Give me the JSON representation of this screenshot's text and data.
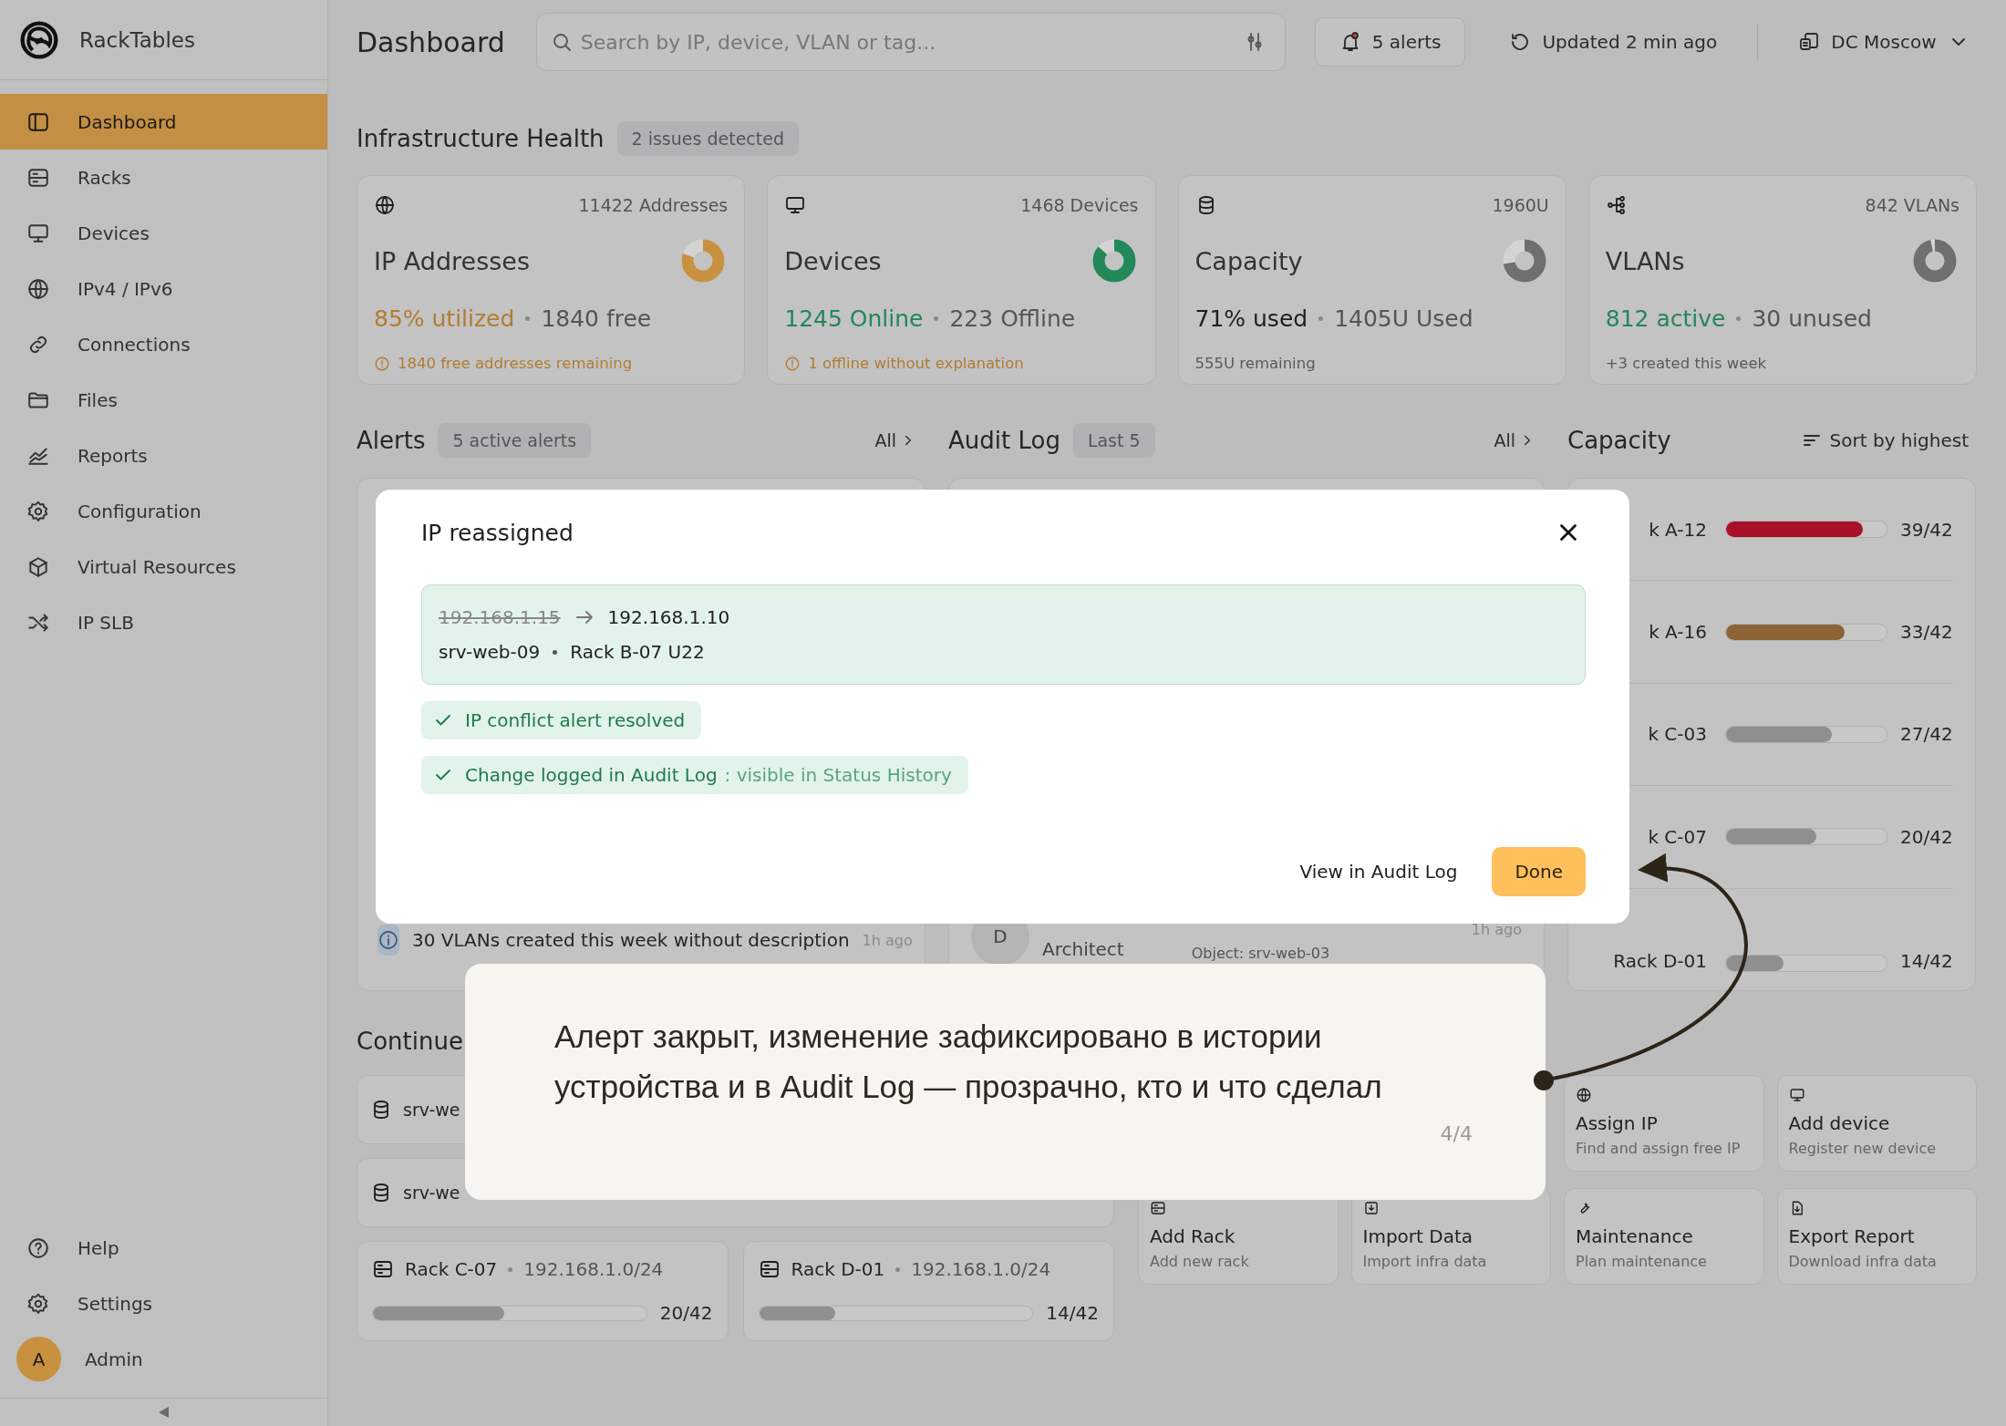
{
  "sidebar": {
    "brand": "RackTables",
    "items": [
      {
        "label": "Dashboard",
        "selected": true
      },
      {
        "label": "Racks",
        "selected": false
      },
      {
        "label": "Devices",
        "selected": false
      },
      {
        "label": "IPv4 / IPv6",
        "selected": false
      },
      {
        "label": "Connections",
        "selected": false
      },
      {
        "label": "Files",
        "selected": false
      },
      {
        "label": "Reports",
        "selected": false
      },
      {
        "label": "Configuration",
        "selected": false
      },
      {
        "label": "Virtual Resources",
        "selected": false
      },
      {
        "label": "IP SLB",
        "selected": false
      }
    ],
    "footer_items": [
      {
        "label": "Help"
      },
      {
        "label": "Settings"
      }
    ],
    "user": {
      "initial": "A",
      "name": "Admin"
    }
  },
  "header": {
    "title": "Dashboard",
    "search": {
      "placeholder": "Search by IP, device, VLAN or tag..."
    },
    "alerts_button": "5 alerts",
    "updated": "Updated 2 min ago",
    "datacenter": "DC Moscow"
  },
  "health": {
    "title": "Infrastructure Health",
    "badge": "2 issues detected",
    "cards": [
      {
        "total": "11422 Addresses",
        "name": "IP Addresses",
        "level": 0.8,
        "color": "#c8913f",
        "primary": "85% utilized",
        "kind": "warning",
        "secondary": "1840 free",
        "note": "1840 free addresses remaining",
        "warning": true
      },
      {
        "total": "1468 Devices",
        "name": "Devices",
        "level": 0.86,
        "color": "#23885a",
        "primary": "1245 Online",
        "kind": "ok",
        "secondary": "223 Offline",
        "note": "1 offline without explanation",
        "warning": true
      },
      {
        "total": "1960U",
        "name": "Capacity",
        "level": 0.72,
        "color": "#6f6f6f",
        "primary": "71% used",
        "kind": "plain",
        "secondary": "1405U Used",
        "note": "555U remaining",
        "warning": false
      },
      {
        "total": "842 VLANs",
        "name": "VLANs",
        "level": 0.96,
        "color": "#6f6f6f",
        "primary": "812 active",
        "kind": "ok",
        "secondary": "30 unused",
        "note": "+3 created this week",
        "warning": false
      }
    ]
  },
  "alerts": {
    "title": "Alerts",
    "badge": "5 active alerts",
    "link": "All",
    "rows": [
      {
        "text": "30 VLANs created this week without description",
        "time": "1h ago"
      }
    ]
  },
  "audit_log": {
    "title": "Audit Log",
    "badge": "Last 5",
    "link": "All",
    "rows": [
      {
        "avatar": "D",
        "role": "Architect",
        "object": "Object: srv-web-03",
        "time": "1h ago"
      }
    ]
  },
  "capacity": {
    "title": "Capacity",
    "sort": "Sort by highest",
    "racks": [
      {
        "name": "k A-12",
        "level": 0.85,
        "color": "#a8102a",
        "reading": "39/42"
      },
      {
        "name": "k A-16",
        "level": 0.74,
        "color": "#8c6436",
        "reading": "33/42"
      },
      {
        "name": "k C-03",
        "level": 0.66,
        "color": "#8f8f8f",
        "reading": "27/42"
      },
      {
        "name": "k C-07",
        "level": 0.56,
        "color": "#8f8f8f",
        "reading": "20/42"
      },
      {
        "name": "Rack D-01",
        "level": 0.36,
        "color": "#8f8f8f",
        "reading": "14/42"
      }
    ]
  },
  "continue": {
    "title": "Continue",
    "items": [
      {
        "label": "srv-we"
      },
      {
        "label": "srv-we"
      }
    ],
    "racks": [
      {
        "name": "Rack C-07",
        "subnet": "192.168.1.0/24",
        "level": 0.48,
        "reading": "20/42"
      },
      {
        "name": "Rack D-01",
        "subnet": "192.168.1.0/24",
        "level": 0.28,
        "reading": "14/42"
      }
    ]
  },
  "quick_actions": {
    "top": [
      {
        "title": "Assign IP",
        "subtitle": "Find and assign free IP"
      },
      {
        "title": "Add device",
        "subtitle": "Register new device"
      }
    ],
    "bottom": [
      {
        "title": "Add Rack",
        "subtitle": "Add new rack"
      },
      {
        "title": "Import Data",
        "subtitle": "Import infra data"
      },
      {
        "title": "Maintenance",
        "subtitle": "Plan maintenance"
      },
      {
        "title": "Export Report",
        "subtitle": "Download infra data"
      }
    ]
  },
  "dialog": {
    "title": "IP reassigned",
    "old_ip": "192.168.1.15",
    "new_ip": "192.168.1.10",
    "device": "srv-web-09",
    "location": "Rack B-07 U22",
    "checks": [
      {
        "label": "IP conflict alert resolved"
      },
      {
        "label": "Change logged in Audit Log",
        "detail": ": visible in Status History"
      }
    ],
    "link": "View in Audit Log",
    "primary": "Done"
  },
  "tour": {
    "text": "Алерт закрыт, изменение зафиксировано в истории устройства и в Audit Log — прозрачно, кто и что сделал",
    "step": "4/4"
  }
}
